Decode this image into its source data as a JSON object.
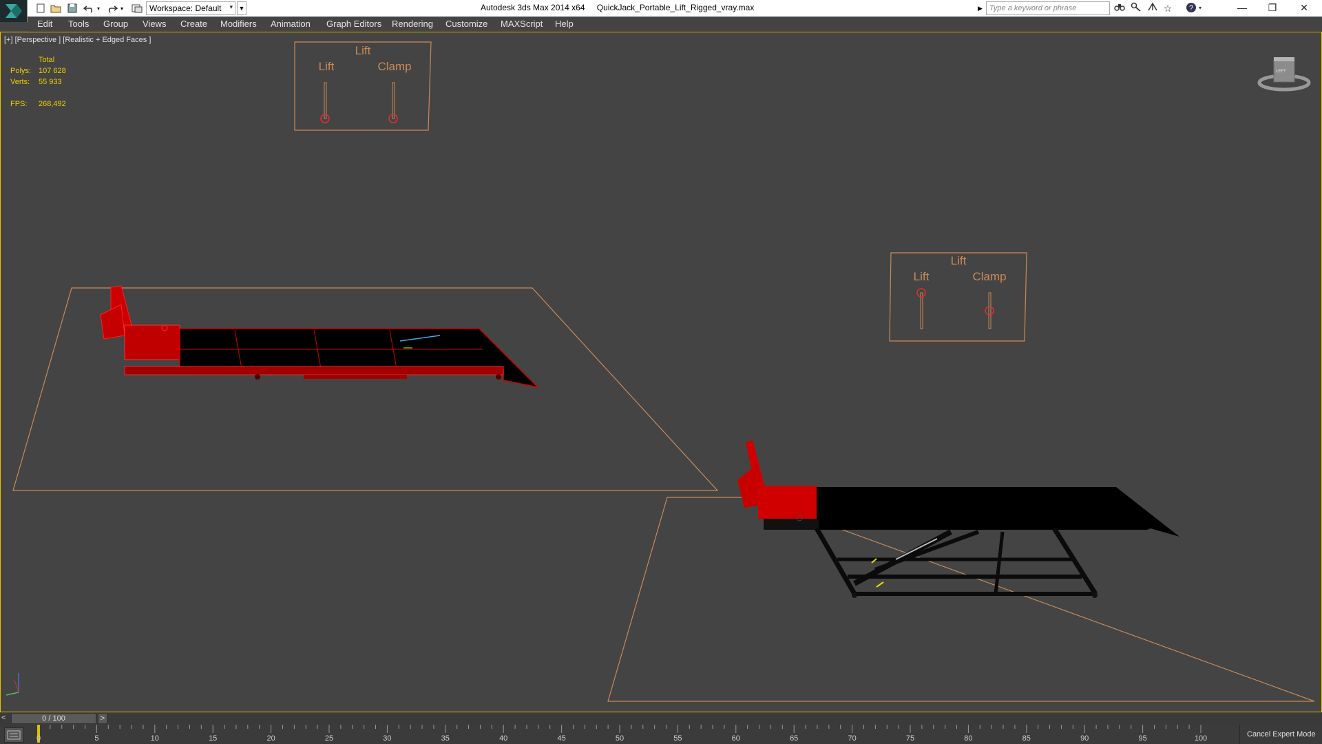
{
  "titlebar": {
    "workspace_label": "Workspace: Default",
    "app_title": "Autodesk 3ds Max  2014 x64",
    "file_title": "QuickJack_Portable_Lift_Rigged_vray.max",
    "search_placeholder": "Type a keyword or phrase",
    "minimize_glyph": "—",
    "restore_glyph": "❐",
    "close_glyph": "✕"
  },
  "menu": {
    "items": [
      "Edit",
      "Tools",
      "Group",
      "Views",
      "Create",
      "Modifiers",
      "Animation",
      "Graph Editors",
      "Rendering",
      "Customize",
      "MAXScript",
      "Help"
    ]
  },
  "viewport": {
    "label": "[+] [Perspective ] [Realistic + Edged Faces ]",
    "stats": {
      "total_label": "Total",
      "polys_label": "Polys:",
      "polys_value": "107 628",
      "verts_label": "Verts:",
      "verts_value": "55 933",
      "fps_label": "FPS:",
      "fps_value": "268,492"
    },
    "controls": [
      {
        "title": "Lift",
        "left_label": "Lift",
        "right_label": "Clamp"
      },
      {
        "title": "Lift",
        "left_label": "Lift",
        "right_label": "Clamp"
      }
    ],
    "viewcube_label": "LEFT"
  },
  "timeline": {
    "frame_display": "0 / 100",
    "prev_glyph": "<",
    "next_glyph": ">",
    "ticks": [
      "0",
      "5",
      "10",
      "15",
      "20",
      "25",
      "30",
      "35",
      "40",
      "45",
      "50",
      "55",
      "60",
      "65",
      "70",
      "75",
      "80",
      "85",
      "90",
      "95",
      "100"
    ],
    "current_frame": 0,
    "cancel_expert_label": "Cancel Expert Mode"
  },
  "colors": {
    "viewport_bg": "#444444",
    "active_border": "#e8c000",
    "stats_text": "#f0d000",
    "control_text": "#c98a58",
    "model_red": "#d10000"
  }
}
